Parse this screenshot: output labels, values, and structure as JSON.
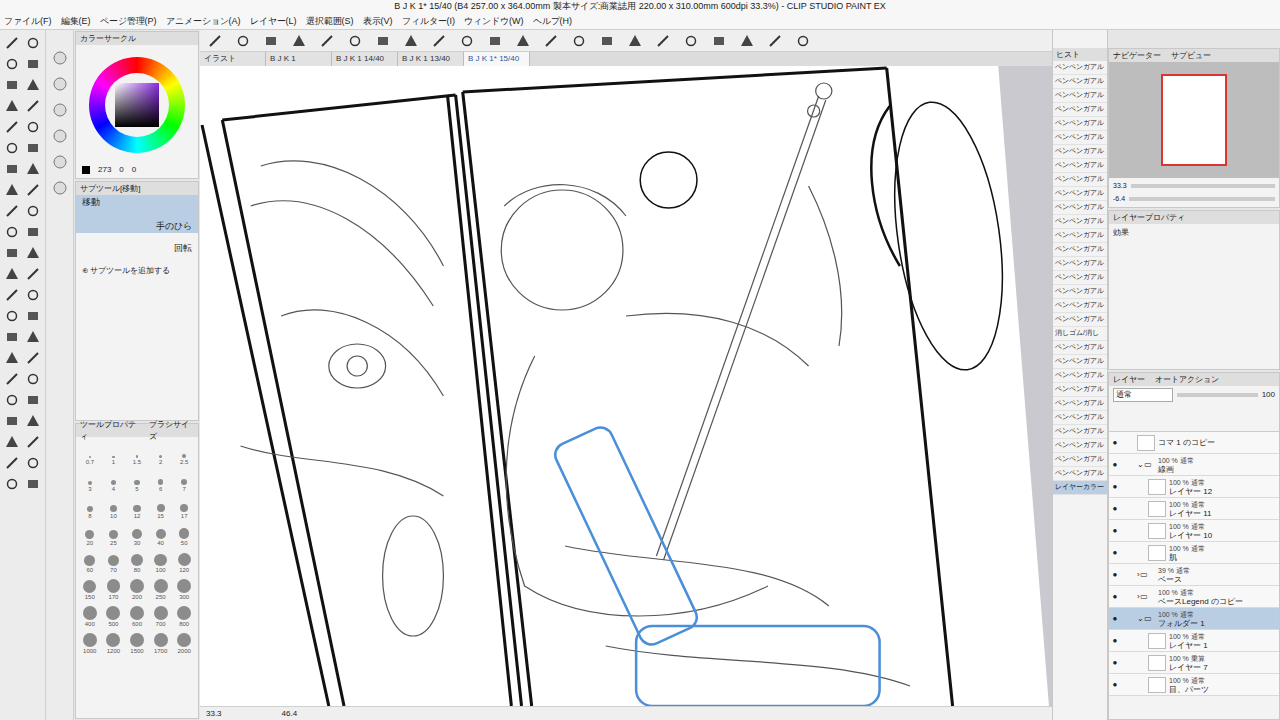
{
  "window": {
    "title": "B J K 1* 15/40 (B4 257.00 x 364.00mm 製本サイズ:商業誌用 220.00 x 310.00mm 600dpi 33.3%) - CLIP STUDIO PAINT EX"
  },
  "menu": [
    "ファイル(F)",
    "編集(E)",
    "ページ管理(P)",
    "アニメーション(A)",
    "レイヤー(L)",
    "選択範囲(S)",
    "表示(V)",
    "フィルター(I)",
    "ウィンドウ(W)",
    "ヘルプ(H)"
  ],
  "tabs": [
    {
      "label": "イラスト",
      "selected": false
    },
    {
      "label": "B J K 1",
      "selected": false
    },
    {
      "label": "B J K 1 14/40",
      "selected": false
    },
    {
      "label": "B J K 1 13/40",
      "selected": false
    },
    {
      "label": "B J K 1* 15/40",
      "selected": true
    }
  ],
  "color_panel": {
    "tab": "カラーサークル",
    "values": [
      "273",
      "0",
      "0"
    ]
  },
  "sub_tool": {
    "title": "サブツール[移動]",
    "group": "移動",
    "items": [
      {
        "label": "手のひら",
        "selected": true
      },
      {
        "label": "回転",
        "selected": false
      }
    ],
    "add": "サブツールを追加する"
  },
  "brush_size": {
    "tabs": [
      "ツールプロパティ",
      "ブラシサイズ"
    ],
    "sizes": [
      "0.7",
      "1",
      "1.5",
      "2",
      "2.5",
      "3",
      "4",
      "5",
      "6",
      "7",
      "8",
      "10",
      "12",
      "15",
      "17",
      "20",
      "25",
      "30",
      "40",
      "50",
      "60",
      "70",
      "80",
      "100",
      "120",
      "150",
      "170",
      "200",
      "250",
      "300",
      "400",
      "500",
      "600",
      "700",
      "800",
      "1000",
      "1200",
      "1500",
      "1700",
      "2000"
    ]
  },
  "history": {
    "tab": "ヒスト",
    "items": [
      {
        "label": "ペンペンガアル",
        "selected": false
      },
      {
        "label": "ペンペンガアル",
        "selected": false
      },
      {
        "label": "ペンペンガアル",
        "selected": false
      },
      {
        "label": "ペンペンガアル",
        "selected": false
      },
      {
        "label": "ペンペンガアル",
        "selected": false
      },
      {
        "label": "ペンペンガアル",
        "selected": false
      },
      {
        "label": "ペンペンガアル",
        "selected": false
      },
      {
        "label": "ペンペンガアル",
        "selected": false
      },
      {
        "label": "ペンペンガアル",
        "selected": false
      },
      {
        "label": "ペンペンガアル",
        "selected": false
      },
      {
        "label": "ペンペンガアル",
        "selected": false
      },
      {
        "label": "ペンペンガアル",
        "selected": false
      },
      {
        "label": "ペンペンガアル",
        "selected": false
      },
      {
        "label": "ペンペンガアル",
        "selected": false
      },
      {
        "label": "ペンペンガアル",
        "selected": false
      },
      {
        "label": "ペンペンガアル",
        "selected": false
      },
      {
        "label": "ペンペンガアル",
        "selected": false
      },
      {
        "label": "ペンペンガアル",
        "selected": false
      },
      {
        "label": "ペンペンガアル",
        "selected": false
      },
      {
        "label": "消しゴム/消し",
        "selected": false
      },
      {
        "label": "ペンペンガアル",
        "selected": false
      },
      {
        "label": "ペンペンガアル",
        "selected": false
      },
      {
        "label": "ペンペンガアル",
        "selected": false
      },
      {
        "label": "ペンペンガアル",
        "selected": false
      },
      {
        "label": "ペンペンガアル",
        "selected": false
      },
      {
        "label": "ペンペンガアル",
        "selected": false
      },
      {
        "label": "ペンペンガアル",
        "selected": false
      },
      {
        "label": "ペンペンガアル",
        "selected": false
      },
      {
        "label": "ペンペンガアル",
        "selected": false
      },
      {
        "label": "ペンペンガアル",
        "selected": false
      },
      {
        "label": "レイヤーカラー",
        "selected": true
      }
    ]
  },
  "navigator": {
    "tabs": [
      "ナビゲーター",
      "サブビュー"
    ],
    "zoom": "33.3",
    "rotation": "-6.4"
  },
  "layer_property": {
    "title": "レイヤープロパティ",
    "effect": "効果"
  },
  "layers": {
    "tabs": [
      "レイヤー",
      "オートアクション"
    ],
    "blend": "通常",
    "opacity": "100",
    "items": [
      {
        "kind": "layer",
        "mode": "",
        "name": "コマ 1 のコピー",
        "indent": false,
        "expanded": false,
        "selected": false,
        "visible": true
      },
      {
        "kind": "folder",
        "mode": "100 % 通常",
        "name": "線画",
        "indent": false,
        "expanded": true,
        "selected": false,
        "visible": true
      },
      {
        "kind": "layer",
        "mode": "100 % 通常",
        "name": "レイヤー 12",
        "indent": true,
        "expanded": false,
        "selected": false,
        "visible": true
      },
      {
        "kind": "layer",
        "mode": "100 % 通常",
        "name": "レイヤー 11",
        "indent": true,
        "expanded": false,
        "selected": false,
        "visible": true
      },
      {
        "kind": "layer",
        "mode": "100 % 通常",
        "name": "レイヤー 10",
        "indent": true,
        "expanded": false,
        "selected": false,
        "visible": true
      },
      {
        "kind": "layer",
        "mode": "100 % 通常",
        "name": "肌",
        "indent": true,
        "expanded": false,
        "selected": false,
        "visible": true
      },
      {
        "kind": "folder",
        "mode": "39 % 通常",
        "name": "ベース",
        "indent": false,
        "expanded": false,
        "selected": false,
        "visible": true
      },
      {
        "kind": "folder",
        "mode": "100 % 通常",
        "name": "ベースLegend のコピー",
        "indent": false,
        "expanded": false,
        "selected": false,
        "visible": true
      },
      {
        "kind": "folder",
        "mode": "100 % 通常",
        "name": "フォルダー 1",
        "indent": false,
        "expanded": true,
        "selected": true,
        "visible": true
      },
      {
        "kind": "layer",
        "mode": "100 % 通常",
        "name": "レイヤー 1",
        "indent": true,
        "expanded": false,
        "selected": false,
        "visible": true
      },
      {
        "kind": "layer",
        "mode": "100 % 乗算",
        "name": "レイヤー 7",
        "indent": true,
        "expanded": false,
        "selected": false,
        "visible": true
      },
      {
        "kind": "layer",
        "mode": "100 % 通常",
        "name": "目、パーツ",
        "indent": true,
        "expanded": false,
        "selected": false,
        "visible": true
      }
    ]
  },
  "status": {
    "zoom": "33.3",
    "rotation": "46.4"
  }
}
